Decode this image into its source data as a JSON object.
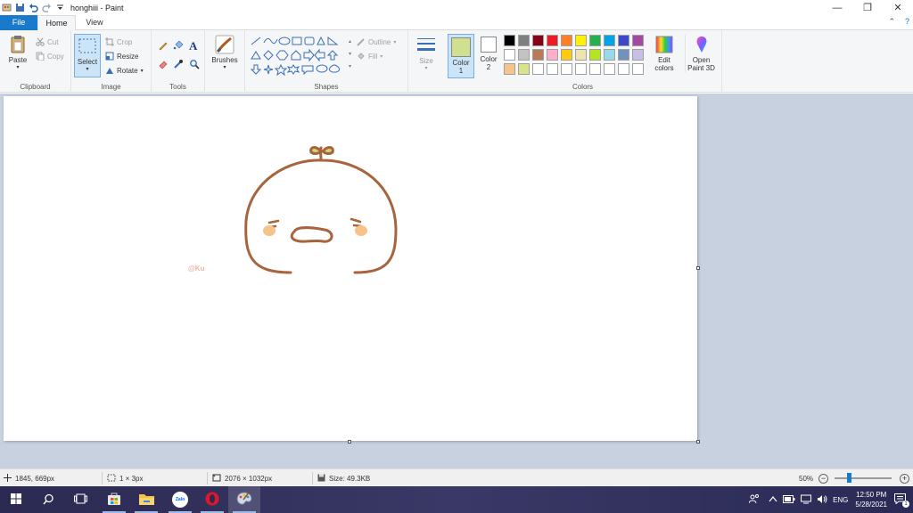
{
  "window": {
    "title": "honghiii - Paint",
    "minimize_glyph": "—",
    "restore_glyph": "❐",
    "close_glyph": "✕"
  },
  "tabs": {
    "file": "File",
    "home": "Home",
    "view": "View",
    "help": "?",
    "collapse": "⌃"
  },
  "clipboard": {
    "paste": "Paste",
    "cut": "Cut",
    "copy": "Copy",
    "label": "Clipboard"
  },
  "image": {
    "select": "Select",
    "crop": "Crop",
    "resize": "Resize",
    "rotate": "Rotate",
    "label": "Image"
  },
  "tools": {
    "label": "Tools",
    "text_glyph": "A"
  },
  "brushes": {
    "label": "Brushes"
  },
  "shapes": {
    "label": "Shapes",
    "outline": "Outline",
    "fill": "Fill"
  },
  "size": {
    "label": "Size"
  },
  "colors": {
    "label": "Colors",
    "color1": "Color 1",
    "color2": "Color 2",
    "edit_colors": "Edit colors",
    "open_paint3d": "Open Paint 3D",
    "color1_value": "#cfe08f",
    "color2_value": "#ffffff",
    "palette": [
      "#000000",
      "#7f7f7f",
      "#880015",
      "#ed1c24",
      "#ff7f27",
      "#fff200",
      "#22b14c",
      "#00a2e8",
      "#3f48cc",
      "#a349a4",
      "#ffffff",
      "#c3c3c3",
      "#b97a57",
      "#ffaec9",
      "#ffc90e",
      "#efe4b0",
      "#b5e61d",
      "#99d9ea",
      "#7092be",
      "#c8bfe7",
      "#f6c38a",
      "#d9e38a",
      "#ffffff",
      "#ffffff",
      "#ffffff",
      "#ffffff",
      "#ffffff",
      "#ffffff",
      "#ffffff",
      "#ffffff"
    ]
  },
  "canvas": {
    "watermark": "@Ku"
  },
  "status": {
    "cursor_pos": "1845, 669px",
    "selection_size": "1 × 3px",
    "image_size": "2076 × 1032px",
    "file_size": "Size: 49.3KB",
    "zoom": "50%",
    "zoom_minus": "−",
    "zoom_plus": "+"
  },
  "taskbar": {
    "time": "12:50 PM",
    "date": "5/28/2021",
    "lang": "ENG",
    "zalo": "Zalo"
  }
}
